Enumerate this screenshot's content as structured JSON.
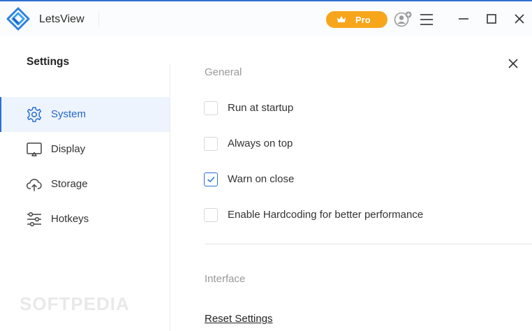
{
  "app": {
    "title": "LetsView",
    "pro_label": "Pro",
    "brand_color": "#2f6fcf",
    "pro_color": "#f7a51b",
    "icons": [
      "letsview-logo-icon",
      "crown-icon",
      "avatar-icon",
      "hamburger-menu-icon",
      "minimize-icon",
      "maximize-icon",
      "close-icon"
    ]
  },
  "settings": {
    "title": "Settings",
    "close_icon": "close-icon",
    "sidebar": {
      "items": [
        {
          "label": "System",
          "icon": "gear-icon",
          "active": true
        },
        {
          "label": "Display",
          "icon": "monitor-icon",
          "active": false
        },
        {
          "label": "Storage",
          "icon": "cloud-icon",
          "active": false
        },
        {
          "label": "Hotkeys",
          "icon": "sliders-icon",
          "active": false
        }
      ]
    },
    "general": {
      "heading": "General",
      "options": [
        {
          "label": "Run at startup",
          "checked": false
        },
        {
          "label": "Always on top",
          "checked": false
        },
        {
          "label": "Warn on close",
          "checked": true
        },
        {
          "label": "Enable Hardcoding for better performance",
          "checked": false
        }
      ]
    },
    "interface": {
      "heading": "Interface",
      "reset_label": "Reset Settings"
    }
  },
  "watermark": "SOFTPEDIA"
}
